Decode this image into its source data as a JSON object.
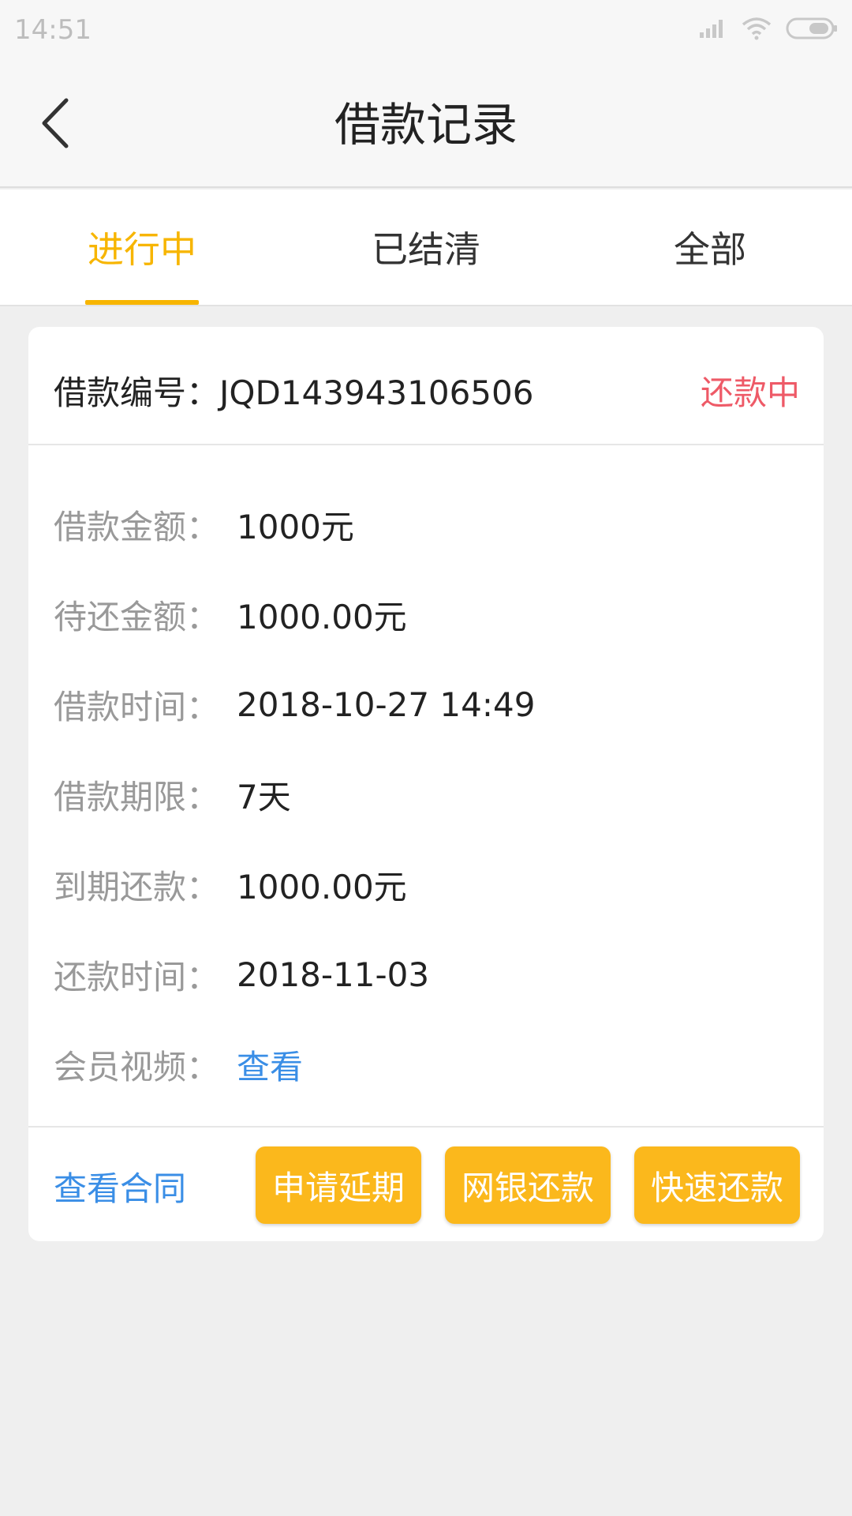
{
  "status_bar": {
    "time": "14:51",
    "icons": [
      "signal-icon",
      "wifi-icon",
      "battery-icon"
    ]
  },
  "header": {
    "title": "借款记录",
    "back_icon": "chevron-left-icon"
  },
  "tabs": [
    {
      "label": "进行中",
      "active": true
    },
    {
      "label": "已结清",
      "active": false
    },
    {
      "label": "全部",
      "active": false
    }
  ],
  "loan": {
    "number_label": "借款编号：",
    "number": "JQD143943106506",
    "status": "还款中",
    "rows": [
      {
        "key": "借款金额：",
        "value": "1000元"
      },
      {
        "key": "待还金额：",
        "value": "1000.00元"
      },
      {
        "key": "借款时间：",
        "value": "2018-10-27 14:49"
      },
      {
        "key": "借款期限：",
        "value": "7天"
      },
      {
        "key": "到期还款：",
        "value": "1000.00元"
      },
      {
        "key": "还款时间：",
        "value": "2018-11-03"
      },
      {
        "key": "会员视频：",
        "value": "查看"
      }
    ],
    "contract_link": "查看合同",
    "buttons": [
      "申请延期",
      "网银还款",
      "快速还款"
    ]
  },
  "colors": {
    "accent": "#f7b500",
    "button": "#fbb81c",
    "status": "#ee5a67",
    "link": "#3a8ee6",
    "background": "#efefef"
  }
}
